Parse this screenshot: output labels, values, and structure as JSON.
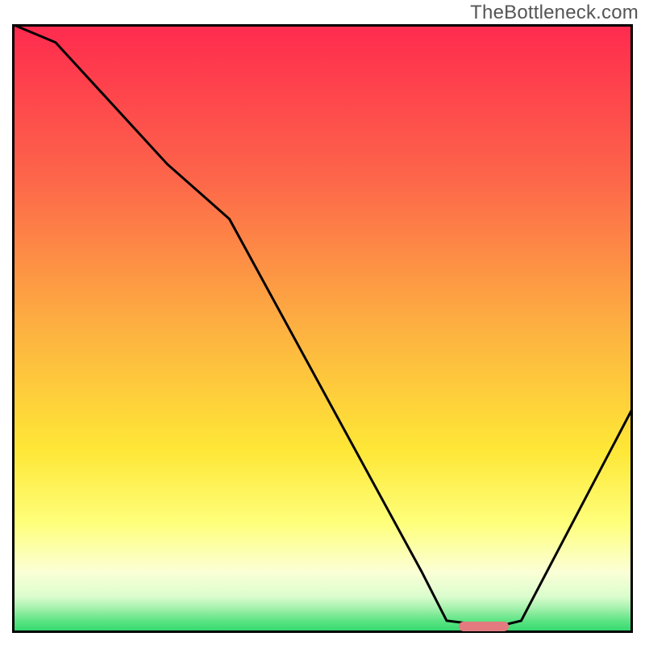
{
  "watermark": {
    "text": "TheBottleneck.com"
  },
  "chart_data": {
    "type": "line",
    "title": "",
    "xlabel": "",
    "ylabel": "",
    "xlim": [
      0,
      100
    ],
    "ylim": [
      0,
      100
    ],
    "gradient_stops": [
      {
        "offset": 0,
        "color": "#fe2a4e"
      },
      {
        "offset": 25,
        "color": "#fd654a"
      },
      {
        "offset": 50,
        "color": "#fdb141"
      },
      {
        "offset": 70,
        "color": "#fee736"
      },
      {
        "offset": 82,
        "color": "#feff7b"
      },
      {
        "offset": 90,
        "color": "#fbffd6"
      },
      {
        "offset": 94,
        "color": "#dbfdce"
      },
      {
        "offset": 96,
        "color": "#a3f1ac"
      },
      {
        "offset": 98,
        "color": "#5de484"
      },
      {
        "offset": 100,
        "color": "#2bd76b"
      }
    ],
    "series": [
      {
        "name": "bottleneck-curve",
        "stroke": "#000000",
        "x": [
          0,
          7,
          25,
          35,
          66,
          70,
          78,
          82,
          100
        ],
        "y": [
          100,
          97,
          77,
          68,
          10,
          2,
          1,
          2,
          37
        ]
      }
    ],
    "optimal_marker": {
      "name": "optimal-range",
      "color": "#e37a7f",
      "x_start": 72,
      "x_end": 80,
      "y": 1
    },
    "axes": {
      "show_ticks": false,
      "show_frame": true,
      "frame_color": "#000000",
      "frame_width": 3
    }
  }
}
